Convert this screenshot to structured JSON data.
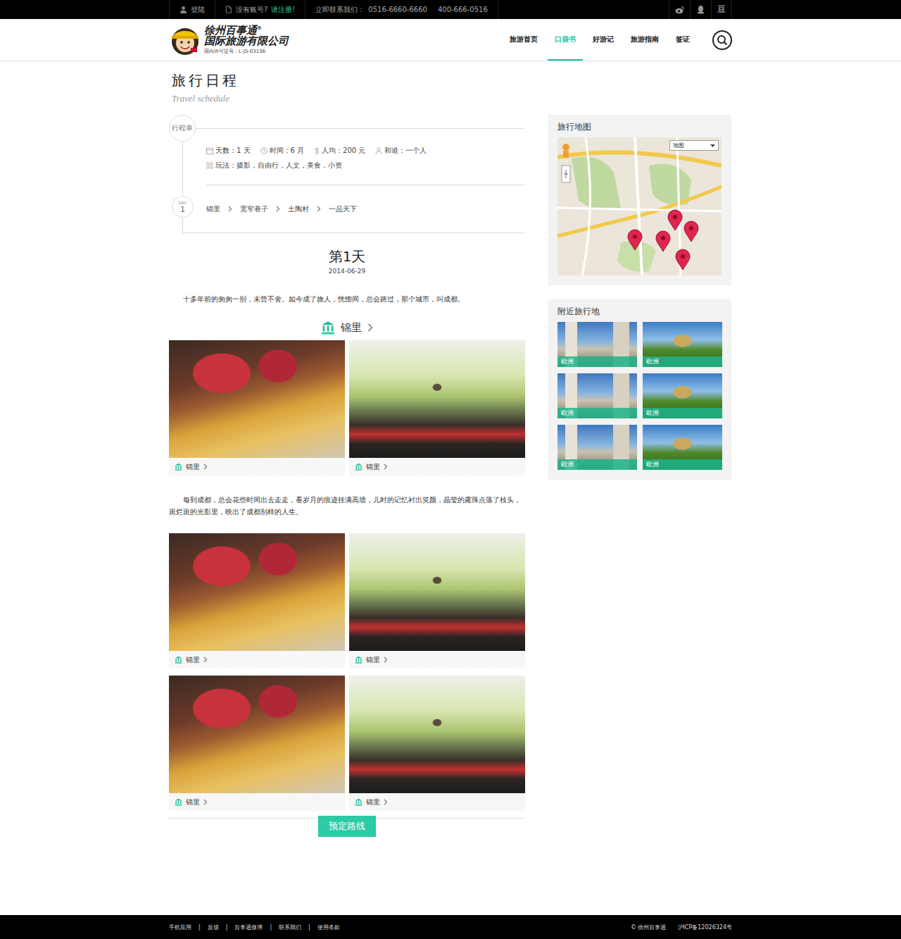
{
  "topbar": {
    "login": "登陆",
    "no_account": "没有账号?",
    "register": "请注册!",
    "contact_label": "立即联系我们：",
    "phones": [
      "0516-6660-6660",
      "400-666-0516"
    ],
    "douban": "豆"
  },
  "logo": {
    "name": "徐州百事通",
    "reg": "®",
    "company": "国际旅游有限公司",
    "license": "国内许可证号：L-JS-03136"
  },
  "nav": [
    {
      "label": "旅游首页",
      "selected": false
    },
    {
      "label": "口袋书",
      "selected": true
    },
    {
      "label": "好游记",
      "selected": false
    },
    {
      "label": "旅游指南",
      "selected": false
    },
    {
      "label": "签证",
      "selected": false
    }
  ],
  "page": {
    "title": "旅行日程",
    "subtitle": "Travel schedule"
  },
  "itinerary": {
    "badge": "行程单",
    "facts": [
      "天数：1 天",
      "时间：6 月",
      "人均：200 元",
      "和谁：一个人"
    ],
    "play": "玩法：摄影，自由行，人文，美食，小资",
    "day_label": "DAY",
    "day_number": "1",
    "route": [
      "锦里",
      "宽窄巷子",
      "土陶村",
      "一品天下"
    ]
  },
  "day": {
    "title": "第1天",
    "date": "2014-06-29",
    "blocks": [
      {
        "kind": "text",
        "text": "十多年前的匆匆一别，未曾不舍。如今成了旅人，恍惚间，总会路过，那个城市，叫成都。"
      },
      {
        "kind": "heading",
        "text": "锦里"
      },
      {
        "kind": "photos",
        "items": [
          {
            "caption": "锦里"
          },
          {
            "caption": "锦里"
          }
        ]
      },
      {
        "kind": "text",
        "text": "每到成都，总会花些时间出去走走，看岁月的痕迹挂满高墙，儿时的记忆衬出笑颜，晶莹的露珠点落了枝头，斑烂斑的光影里，映出了成都别样的人生。"
      },
      {
        "kind": "photos",
        "items": [
          {
            "caption": "锦里"
          },
          {
            "caption": "锦里"
          }
        ]
      },
      {
        "kind": "photos",
        "items": [
          {
            "caption": "锦里"
          },
          {
            "caption": "锦里"
          }
        ]
      }
    ]
  },
  "book_button": "预定路线",
  "sidebar": {
    "map_title": "旅行地图",
    "map_type": "地图",
    "nearby_title": "附近旅行地",
    "nearby": [
      {
        "label": "欧洲"
      },
      {
        "label": "欧洲"
      },
      {
        "label": "欧洲"
      },
      {
        "label": "欧洲"
      },
      {
        "label": "欧洲"
      },
      {
        "label": "欧洲"
      }
    ]
  },
  "footer": {
    "links": [
      "手机应用",
      "反馈",
      "百事通微博",
      "联系我们",
      "使用条款"
    ],
    "separator": "|",
    "copyright": "© 徐州百事通",
    "icp": "沪ICP备12026324号"
  }
}
